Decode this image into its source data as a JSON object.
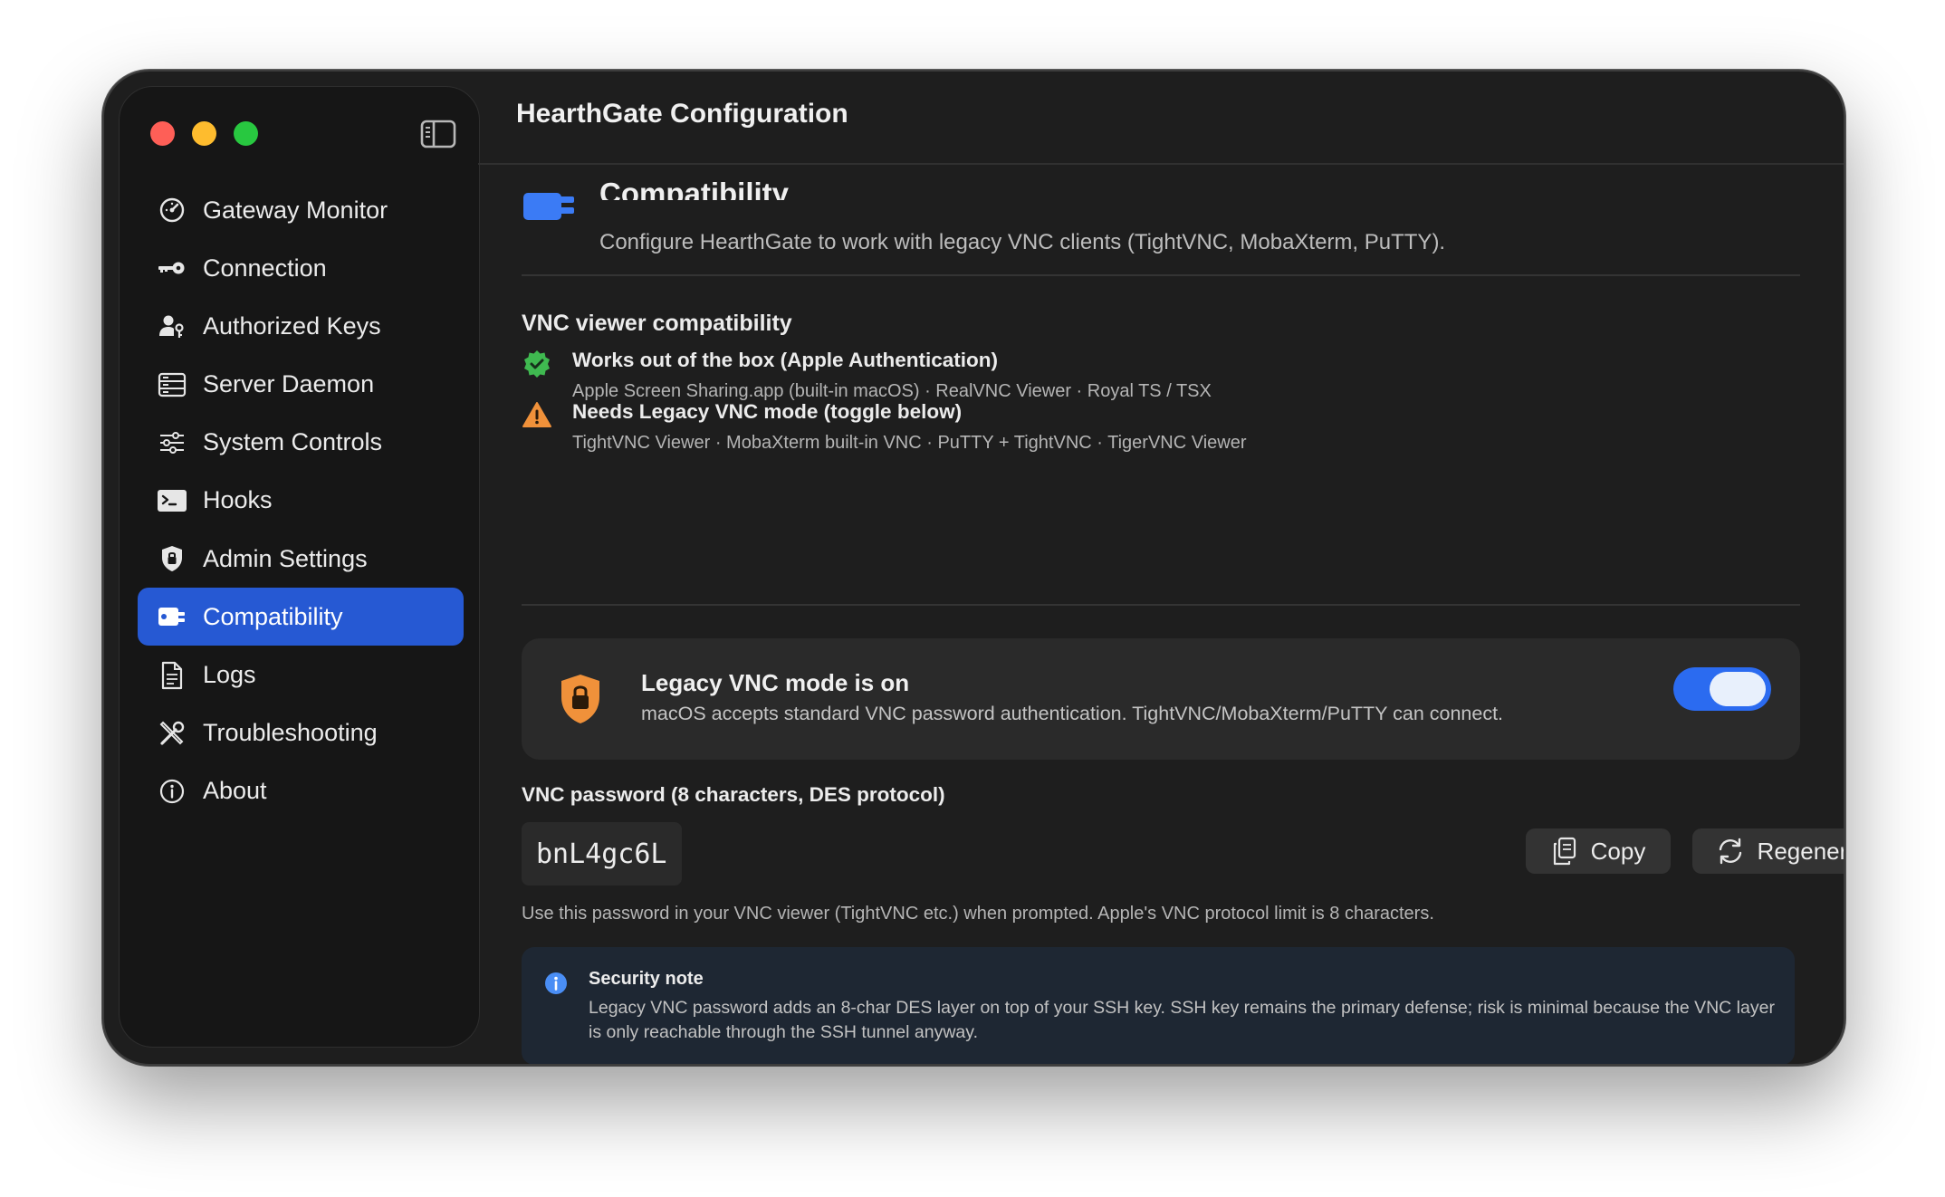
{
  "window": {
    "title": "HearthGate Configuration"
  },
  "sidebar": {
    "items": [
      {
        "label": "Gateway Monitor",
        "icon": "gauge-icon"
      },
      {
        "label": "Connection",
        "icon": "key-icon"
      },
      {
        "label": "Authorized Keys",
        "icon": "person-key-icon"
      },
      {
        "label": "Server Daemon",
        "icon": "server-rack-icon"
      },
      {
        "label": "System Controls",
        "icon": "sliders-icon"
      },
      {
        "label": "Hooks",
        "icon": "terminal-icon"
      },
      {
        "label": "Admin Settings",
        "icon": "shield-lock-icon"
      },
      {
        "label": "Compatibility",
        "icon": "puzzle-plug-icon",
        "active": true
      },
      {
        "label": "Logs",
        "icon": "document-icon"
      },
      {
        "label": "Troubleshooting",
        "icon": "wrench-screwdriver-icon"
      },
      {
        "label": "About",
        "icon": "info-circle-icon"
      }
    ]
  },
  "page": {
    "title": "Compatibility",
    "subtitle": "Configure HearthGate to work with legacy VNC clients (TightVNC, MobaXterm, PuTTY)."
  },
  "compat": {
    "section_title": "VNC viewer compatibility",
    "ok": {
      "heading": "Works out of the box (Apple Authentication)",
      "clients": "Apple Screen Sharing.app (built-in macOS) · RealVNC Viewer · Royal TS / TSX"
    },
    "warn": {
      "heading": "Needs Legacy VNC mode (toggle below)",
      "clients": "TightVNC Viewer · MobaXterm built-in VNC · PuTTY + TightVNC · TigerVNC Viewer"
    }
  },
  "legacy": {
    "heading": "Legacy VNC mode is on",
    "description": "macOS accepts standard VNC password authentication. TightVNC/MobaXterm/PuTTY can connect.",
    "enabled": true
  },
  "password": {
    "label": "VNC password (8 characters, DES protocol)",
    "value": "bnL4gc6L",
    "copy_label": "Copy",
    "regenerate_label": "Regenerate",
    "help": "Use this password in your VNC viewer (TightVNC etc.) when prompted. Apple's VNC protocol limit is 8 characters."
  },
  "note": {
    "heading": "Security note",
    "body": "Legacy VNC password adds an 8-char DES layer on top of your SSH key. SSH key remains the primary defense; risk is minimal because the VNC layer is only reachable through the SSH tunnel anyway."
  },
  "colors": {
    "accent": "#2659d3",
    "toggle_on": "#2b6bf0",
    "ok_green": "#3fb950",
    "warn_orange": "#f0913a",
    "info_blue": "#4a8ef5"
  }
}
